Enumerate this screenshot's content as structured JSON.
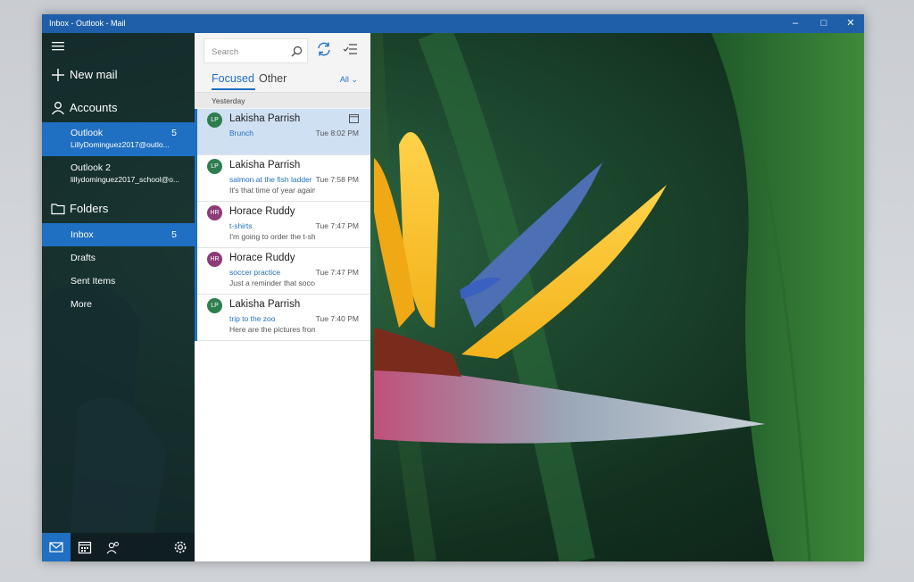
{
  "window": {
    "title": "Inbox - Outlook - Mail",
    "controls": [
      "minimize",
      "maximize",
      "close"
    ]
  },
  "nav": {
    "new_mail": "New mail",
    "accounts_label": "Accounts",
    "accounts": [
      {
        "name": "Outlook",
        "email": "LillyDominguez2017@outlo...",
        "count": "5",
        "selected": true
      },
      {
        "name": "Outlook 2",
        "email": "lillydominguez2017_school@o...",
        "count": "",
        "selected": false
      }
    ],
    "folders_label": "Folders",
    "folders": [
      {
        "name": "Inbox",
        "count": "5",
        "selected": true
      },
      {
        "name": "Drafts",
        "count": ""
      },
      {
        "name": "Sent Items",
        "count": ""
      },
      {
        "name": "More",
        "count": ""
      }
    ],
    "bottom_icons": [
      "mail-icon",
      "calendar-icon",
      "people-icon",
      "settings-icon"
    ],
    "accent": "#1f6fc2"
  },
  "list": {
    "search_placeholder": "Search",
    "tabs": [
      "Focused",
      "Other"
    ],
    "filter": "All",
    "group": "Yesterday",
    "messages": [
      {
        "initials": "LP",
        "from": "Lakisha Parrish",
        "subject": "Brunch",
        "preview": "",
        "time": "Tue 8:02 PM",
        "avatar_color": "#2e7d4f",
        "selected": true,
        "flag": "calendar-icon"
      },
      {
        "initials": "LP",
        "from": "Lakisha Parrish",
        "subject": "salmon at the fish ladder",
        "preview": "It's that time of year again",
        "time": "Tue 7:58 PM",
        "avatar_color": "#2e7d4f"
      },
      {
        "initials": "HR",
        "from": "Horace Ruddy",
        "subject": "t-shirts",
        "preview": "I'm going to order the t-shirts",
        "time": "Tue 7:47 PM",
        "avatar_color": "#8e3b7a"
      },
      {
        "initials": "HR",
        "from": "Horace Ruddy",
        "subject": "soccer practice",
        "preview": "Just a reminder that soccer",
        "time": "Tue 7:47 PM",
        "avatar_color": "#8e3b7a"
      },
      {
        "initials": "LP",
        "from": "Lakisha Parrish",
        "subject": "trip to the zoo",
        "preview": "Here are the pictures from",
        "time": "Tue 7:40 PM",
        "avatar_color": "#2e7d4f"
      }
    ]
  }
}
